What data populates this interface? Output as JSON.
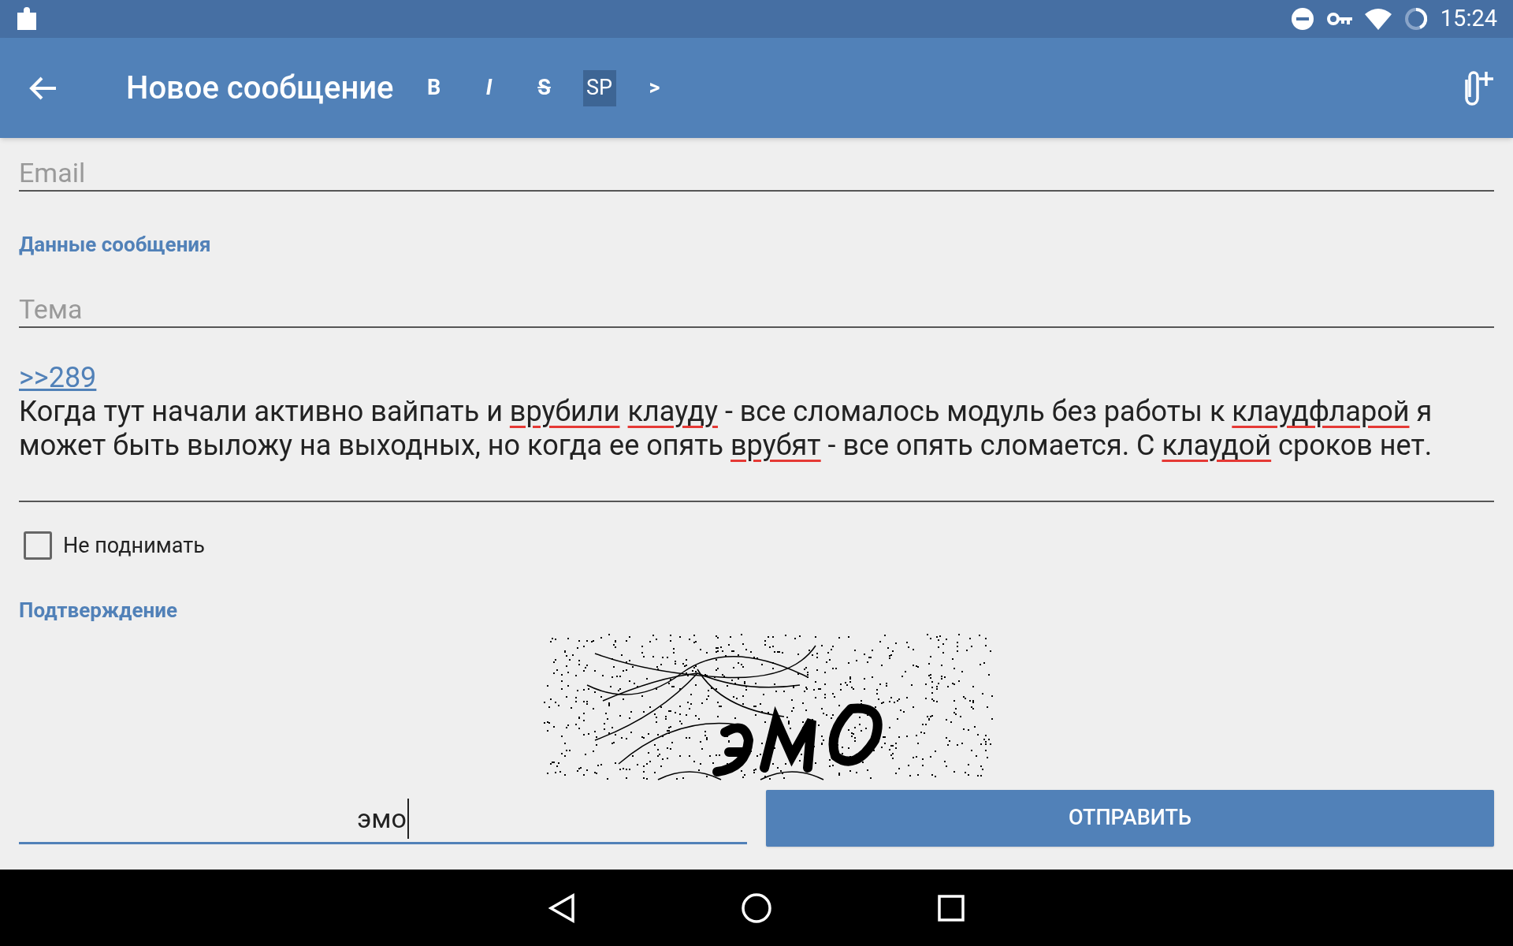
{
  "status_bar": {
    "time": "15:24"
  },
  "toolbar": {
    "title": "Новое сообщение",
    "format_buttons": [
      {
        "label": "B",
        "kind": "bold",
        "selected": false
      },
      {
        "label": "I",
        "kind": "italic",
        "selected": false
      },
      {
        "label": "S",
        "kind": "strike",
        "selected": false
      },
      {
        "label": "SP",
        "kind": "spoiler",
        "selected": true
      },
      {
        "label": ">",
        "kind": "quote",
        "selected": false
      }
    ]
  },
  "email_field": {
    "placeholder": "Email"
  },
  "message_section": {
    "heading": "Данные сообщения"
  },
  "subject_field": {
    "placeholder": "Тема"
  },
  "message_body": {
    "link": ">>289",
    "lines": [
      [
        {
          "text": "Когда тут начали активно вайпать и ",
          "misspelled": false
        },
        {
          "text": "врубили",
          "misspelled": true
        },
        {
          "text": "клауду",
          "misspelled": true
        },
        {
          "text": " - все сломалось модуль без работы к ",
          "misspelled": false
        },
        {
          "text": "клаудфларой",
          "misspelled": true
        },
        {
          "text": " я",
          "misspelled": false
        }
      ],
      [
        {
          "text": "может быть выложу на выходных, но когда ее опять ",
          "misspelled": false
        },
        {
          "text": "врубят",
          "misspelled": true
        },
        {
          "text": " - все опять сломается. С ",
          "misspelled": false
        },
        {
          "text": "клаудой",
          "misspelled": true
        },
        {
          "text": " сроков нет.",
          "misspelled": false
        }
      ]
    ]
  },
  "no_bump": {
    "label": "Не поднимать",
    "checked": false
  },
  "confirmation_section": {
    "heading": "Подтверждение"
  },
  "captcha_field": {
    "value": "эмо"
  },
  "send_button": {
    "label": "ОТПРАВИТЬ"
  }
}
